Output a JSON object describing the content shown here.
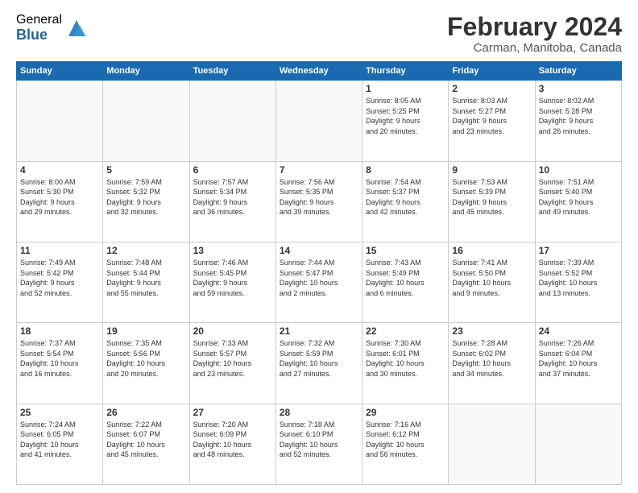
{
  "header": {
    "logo_general": "General",
    "logo_blue": "Blue",
    "month_title": "February 2024",
    "location": "Carman, Manitoba, Canada"
  },
  "columns": [
    "Sunday",
    "Monday",
    "Tuesday",
    "Wednesday",
    "Thursday",
    "Friday",
    "Saturday"
  ],
  "weeks": [
    [
      {
        "day": "",
        "info": ""
      },
      {
        "day": "",
        "info": ""
      },
      {
        "day": "",
        "info": ""
      },
      {
        "day": "",
        "info": ""
      },
      {
        "day": "1",
        "info": "Sunrise: 8:05 AM\nSunset: 5:25 PM\nDaylight: 9 hours\nand 20 minutes."
      },
      {
        "day": "2",
        "info": "Sunrise: 8:03 AM\nSunset: 5:27 PM\nDaylight: 9 hours\nand 23 minutes."
      },
      {
        "day": "3",
        "info": "Sunrise: 8:02 AM\nSunset: 5:28 PM\nDaylight: 9 hours\nand 26 minutes."
      }
    ],
    [
      {
        "day": "4",
        "info": "Sunrise: 8:00 AM\nSunset: 5:30 PM\nDaylight: 9 hours\nand 29 minutes."
      },
      {
        "day": "5",
        "info": "Sunrise: 7:59 AM\nSunset: 5:32 PM\nDaylight: 9 hours\nand 32 minutes."
      },
      {
        "day": "6",
        "info": "Sunrise: 7:57 AM\nSunset: 5:34 PM\nDaylight: 9 hours\nand 36 minutes."
      },
      {
        "day": "7",
        "info": "Sunrise: 7:56 AM\nSunset: 5:35 PM\nDaylight: 9 hours\nand 39 minutes."
      },
      {
        "day": "8",
        "info": "Sunrise: 7:54 AM\nSunset: 5:37 PM\nDaylight: 9 hours\nand 42 minutes."
      },
      {
        "day": "9",
        "info": "Sunrise: 7:53 AM\nSunset: 5:39 PM\nDaylight: 9 hours\nand 45 minutes."
      },
      {
        "day": "10",
        "info": "Sunrise: 7:51 AM\nSunset: 5:40 PM\nDaylight: 9 hours\nand 49 minutes."
      }
    ],
    [
      {
        "day": "11",
        "info": "Sunrise: 7:49 AM\nSunset: 5:42 PM\nDaylight: 9 hours\nand 52 minutes."
      },
      {
        "day": "12",
        "info": "Sunrise: 7:48 AM\nSunset: 5:44 PM\nDaylight: 9 hours\nand 55 minutes."
      },
      {
        "day": "13",
        "info": "Sunrise: 7:46 AM\nSunset: 5:45 PM\nDaylight: 9 hours\nand 59 minutes."
      },
      {
        "day": "14",
        "info": "Sunrise: 7:44 AM\nSunset: 5:47 PM\nDaylight: 10 hours\nand 2 minutes."
      },
      {
        "day": "15",
        "info": "Sunrise: 7:43 AM\nSunset: 5:49 PM\nDaylight: 10 hours\nand 6 minutes."
      },
      {
        "day": "16",
        "info": "Sunrise: 7:41 AM\nSunset: 5:50 PM\nDaylight: 10 hours\nand 9 minutes."
      },
      {
        "day": "17",
        "info": "Sunrise: 7:39 AM\nSunset: 5:52 PM\nDaylight: 10 hours\nand 13 minutes."
      }
    ],
    [
      {
        "day": "18",
        "info": "Sunrise: 7:37 AM\nSunset: 5:54 PM\nDaylight: 10 hours\nand 16 minutes."
      },
      {
        "day": "19",
        "info": "Sunrise: 7:35 AM\nSunset: 5:56 PM\nDaylight: 10 hours\nand 20 minutes."
      },
      {
        "day": "20",
        "info": "Sunrise: 7:33 AM\nSunset: 5:57 PM\nDaylight: 10 hours\nand 23 minutes."
      },
      {
        "day": "21",
        "info": "Sunrise: 7:32 AM\nSunset: 5:59 PM\nDaylight: 10 hours\nand 27 minutes."
      },
      {
        "day": "22",
        "info": "Sunrise: 7:30 AM\nSunset: 6:01 PM\nDaylight: 10 hours\nand 30 minutes."
      },
      {
        "day": "23",
        "info": "Sunrise: 7:28 AM\nSunset: 6:02 PM\nDaylight: 10 hours\nand 34 minutes."
      },
      {
        "day": "24",
        "info": "Sunrise: 7:26 AM\nSunset: 6:04 PM\nDaylight: 10 hours\nand 37 minutes."
      }
    ],
    [
      {
        "day": "25",
        "info": "Sunrise: 7:24 AM\nSunset: 6:05 PM\nDaylight: 10 hours\nand 41 minutes."
      },
      {
        "day": "26",
        "info": "Sunrise: 7:22 AM\nSunset: 6:07 PM\nDaylight: 10 hours\nand 45 minutes."
      },
      {
        "day": "27",
        "info": "Sunrise: 7:20 AM\nSunset: 6:09 PM\nDaylight: 10 hours\nand 48 minutes."
      },
      {
        "day": "28",
        "info": "Sunrise: 7:18 AM\nSunset: 6:10 PM\nDaylight: 10 hours\nand 52 minutes."
      },
      {
        "day": "29",
        "info": "Sunrise: 7:16 AM\nSunset: 6:12 PM\nDaylight: 10 hours\nand 56 minutes."
      },
      {
        "day": "",
        "info": ""
      },
      {
        "day": "",
        "info": ""
      }
    ]
  ]
}
